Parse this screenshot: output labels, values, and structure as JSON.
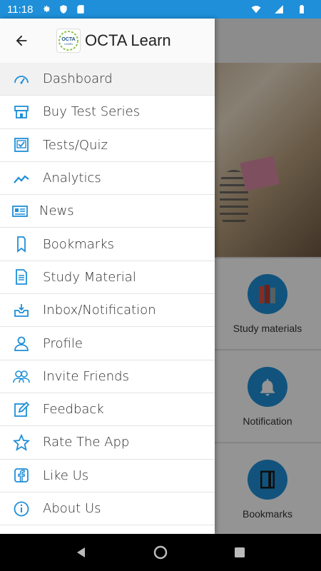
{
  "status_bar": {
    "time": "11:18"
  },
  "app": {
    "title": "OCTA Learn",
    "logo_text": "OCTA",
    "logo_subtext": "LEARN"
  },
  "menu": [
    {
      "label": "Dashboard",
      "icon": "dashboard-icon"
    },
    {
      "label": "Buy Test Series",
      "icon": "store-icon"
    },
    {
      "label": "Tests/Quiz",
      "icon": "quiz-icon"
    },
    {
      "label": "Analytics",
      "icon": "analytics-icon"
    },
    {
      "label": "News",
      "icon": "news-icon"
    },
    {
      "label": "Bookmarks",
      "icon": "bookmark-icon"
    },
    {
      "label": "Study Material",
      "icon": "document-icon"
    },
    {
      "label": "Inbox/Notification",
      "icon": "inbox-icon"
    },
    {
      "label": "Profile",
      "icon": "profile-icon"
    },
    {
      "label": "Invite Friends",
      "icon": "friends-icon"
    },
    {
      "label": "Feedback",
      "icon": "edit-icon"
    },
    {
      "label": "Rate The App",
      "icon": "star-icon"
    },
    {
      "label": "Like Us",
      "icon": "facebook-icon"
    },
    {
      "label": "About Us",
      "icon": "info-icon"
    }
  ],
  "background_cards": [
    {
      "label": "Study materials",
      "icon": "books-icon"
    },
    {
      "label": "Notification",
      "icon": "bell-icon"
    },
    {
      "label": "Bookmarks",
      "icon": "book-icon"
    }
  ],
  "colors": {
    "accent": "#1e8fd8",
    "status_bar": "#1e8fd8"
  }
}
